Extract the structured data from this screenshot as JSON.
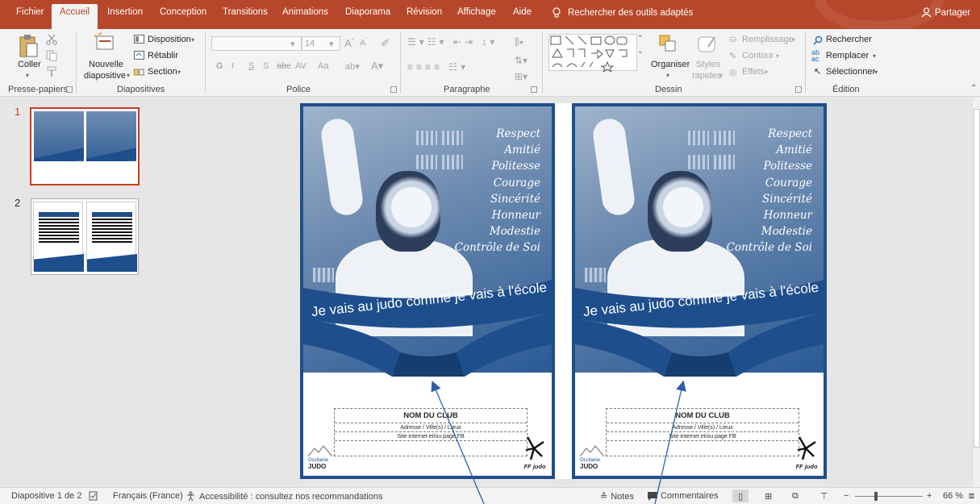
{
  "tabs": {
    "items": [
      "Fichier",
      "Accueil",
      "Insertion",
      "Conception",
      "Transitions",
      "Animations",
      "Diaporama",
      "Révision",
      "Affichage",
      "Aide"
    ],
    "search": "Rechercher des outils adaptés",
    "share": "Partager"
  },
  "ribbon": {
    "clipboard": {
      "paste": "Coller",
      "label": "Presse-papiers"
    },
    "slides": {
      "new_slide_line1": "Nouvelle",
      "new_slide_line2": "diapositive",
      "layout": "Disposition",
      "reset": "Rétablir",
      "section": "Section",
      "label": "Diapositives"
    },
    "font": {
      "size": "14",
      "bold": "G",
      "italic": "I",
      "underline": "S",
      "shadow": "S",
      "strike": "abc",
      "spacing": "AV",
      "case": "Aa",
      "label": "Police"
    },
    "paragraph": {
      "label": "Paragraphe"
    },
    "drawing": {
      "arrange": "Organiser",
      "styles_line1": "Styles",
      "styles_line2": "rapides",
      "fill": "Remplissage",
      "outline": "Contour",
      "effects": "Effets",
      "label": "Dessin"
    },
    "editing": {
      "find": "Rechercher",
      "replace": "Remplacer",
      "select": "Sélectionner",
      "label": "Édition"
    }
  },
  "thumbnails": [
    {
      "number": "1"
    },
    {
      "number": "2"
    }
  ],
  "poster": {
    "values": [
      "Respect",
      "Amitié",
      "Politesse",
      "Courage",
      "Sincérité",
      "Honneur",
      "Modestie",
      "Contrôle de Soi"
    ],
    "slogan": "Je vais au judo comme je vais à l'école",
    "club_name": "NOM DU CLUB",
    "address": "Adresse / Ville(s) / Lieux",
    "website": "Site internet et/ou page FB",
    "logo_left_top": "Occitanie",
    "logo_left_bottom": "JUDO",
    "logo_right": "FF judo"
  },
  "status": {
    "slide_info": "Diapositive 1 de 2",
    "language": "Français (France)",
    "accessibility": "Accessibilité : consultez nos recommandations",
    "notes": "Notes",
    "comments": "Commentaires",
    "zoom": "66 %"
  },
  "colors": {
    "accent": "#b7472a",
    "judo_blue": "#1e4e8c"
  }
}
